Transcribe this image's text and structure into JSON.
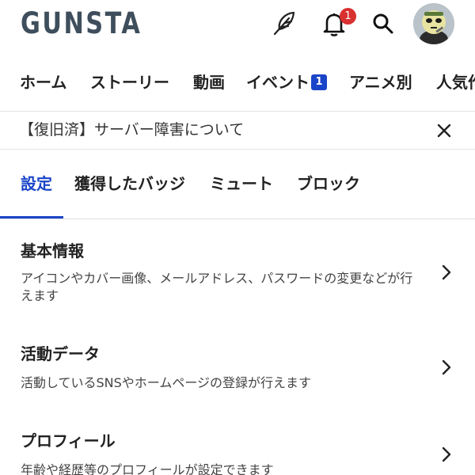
{
  "header": {
    "logo": "GUNSTA",
    "notification_count": "1",
    "icons": [
      "feather-icon",
      "bell-icon",
      "search-icon",
      "avatar"
    ]
  },
  "nav": {
    "items": [
      {
        "label": "ホーム"
      },
      {
        "label": "ストーリー"
      },
      {
        "label": "動画"
      },
      {
        "label": "イベント",
        "badge": "1"
      },
      {
        "label": "アニメ別"
      },
      {
        "label": "人気作"
      }
    ]
  },
  "notice": {
    "text": "【復旧済】サーバー障害について",
    "close_icon": "close-icon"
  },
  "tabs": {
    "items": [
      {
        "label": "設定",
        "active": true
      },
      {
        "label": "獲得したバッジ"
      },
      {
        "label": "ミュート"
      },
      {
        "label": "ブロック"
      }
    ]
  },
  "settings": [
    {
      "title": "基本情報",
      "description": "アイコンやカバー画像、メールアドレス、パスワードの変更などが行えます"
    },
    {
      "title": "活動データ",
      "description": "活動しているSNSやホームページの登録が行えます"
    },
    {
      "title": "プロフィール",
      "description": "年齢や経歴等のプロフィールが設定できます"
    }
  ],
  "colors": {
    "accent": "#1a45c8",
    "badge_red": "#d93030",
    "logo": "#3e4e5c",
    "divider": "#e2e2e2"
  }
}
